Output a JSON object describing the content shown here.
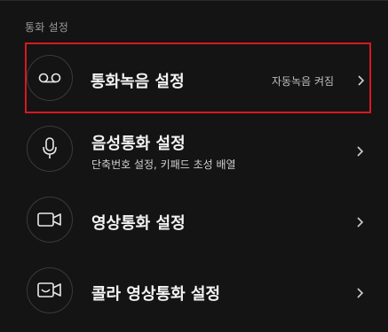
{
  "section": {
    "title": "통화 설정"
  },
  "items": [
    {
      "title": "통화녹음 설정",
      "status": "자동녹음 켜짐",
      "icon": "voicemail-icon",
      "highlighted": true
    },
    {
      "title": "음성통화 설정",
      "subtitle": "단축번호 설정, 키패드 초성 배열",
      "icon": "microphone-icon"
    },
    {
      "title": "영상통화 설정",
      "icon": "video-camera-icon"
    },
    {
      "title": "콜라 영상통화 설정",
      "icon": "video-call-icon"
    }
  ],
  "colors": {
    "background": "#141414",
    "highlight_border": "#d71920",
    "text_primary": "#f3f3f3",
    "text_secondary": "#9a9a9a"
  }
}
